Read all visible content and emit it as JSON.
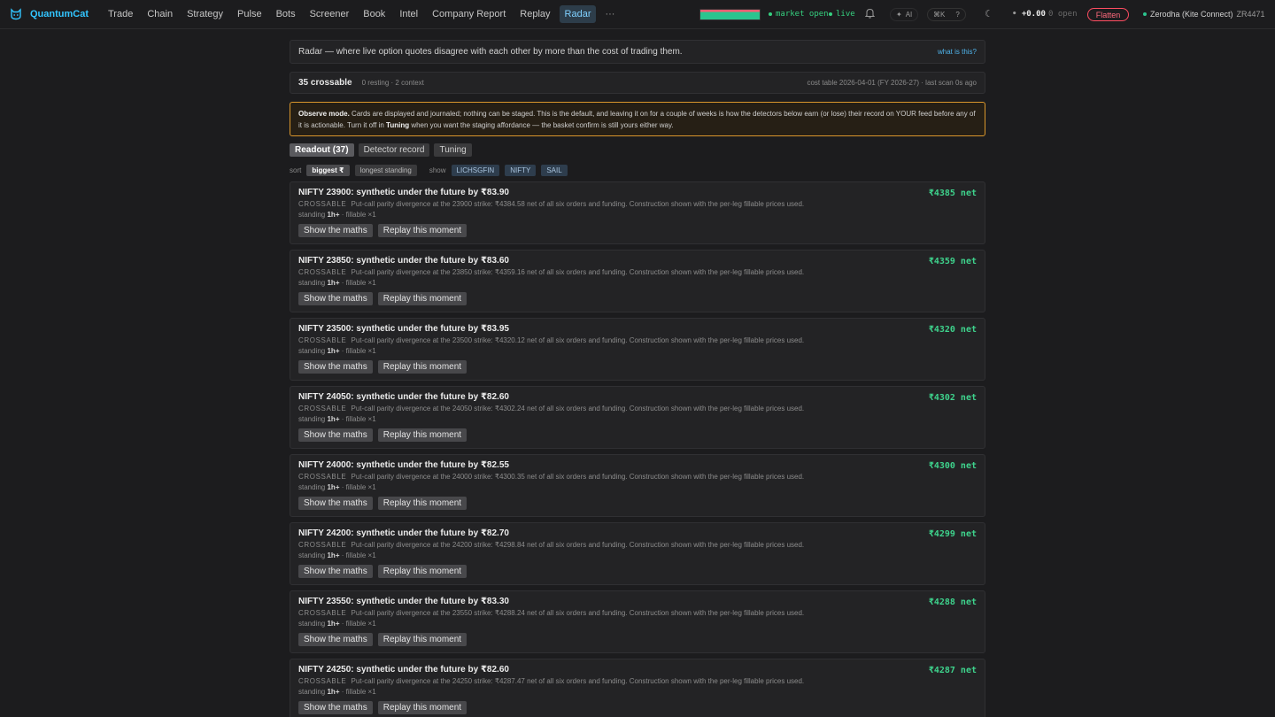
{
  "brand": {
    "name": "QuantumCat",
    "icon": "cat-logo-icon",
    "color": "#32c5ff"
  },
  "nav": {
    "items": [
      "Trade",
      "Chain",
      "Strategy",
      "Pulse",
      "Bots",
      "Screener",
      "Book",
      "Intel",
      "Company Report",
      "Replay",
      "Radar"
    ],
    "active": "Radar",
    "more": "···"
  },
  "status": {
    "market": "market open",
    "live": "live",
    "ai": "AI",
    "shortcut": "⌘K",
    "help": "?",
    "pnl": "+0.00",
    "open": "0 open",
    "flatten": "Flatten",
    "broker": "Zerodha (Kite Connect)",
    "account": "ZR4471",
    "health_fraction": 1.0
  },
  "colors": {
    "accent": "#32c5ff",
    "positive": "#3ed28c",
    "warning_border": "#d9962c",
    "danger": "#ff4d62"
  },
  "intro": {
    "text": "Radar — where live option quotes disagree with each other by more than the cost of trading them.",
    "link": "what is this?"
  },
  "summary": {
    "crossable": "35 crossable",
    "counts": "0 resting · 2 context",
    "scan": "cost table 2026-04-01 (FY 2026-27) · last scan 0s ago"
  },
  "observe": {
    "title": "Observe mode.",
    "body_1": "Cards are displayed and journaled; nothing can be staged. This is the default, and leaving it on for a couple of weeks is how the detectors below earn (or lose) their record on YOUR feed before any of it is actionable. Turn it off in",
    "tuning": "Tuning",
    "body_2": "when you want the staging affordance — the basket confirm is still yours either way."
  },
  "tabs": [
    {
      "label": "Readout (37)",
      "active": true
    },
    {
      "label": "Detector record",
      "active": false
    },
    {
      "label": "Tuning",
      "active": false
    }
  ],
  "sort": {
    "label": "sort",
    "options": [
      "biggest ₹",
      "longest standing"
    ],
    "show_label": "show",
    "show_options": [
      "LICHSGFIN",
      "NIFTY",
      "SAIL"
    ]
  },
  "card_labels": {
    "tag": "CROSSABLE",
    "standing": "standing",
    "maths": "Show the maths",
    "replay": "Replay this moment"
  },
  "cards": [
    {
      "title": "NIFTY 23900: synthetic under the future by ₹83.90",
      "net": "₹4385 net",
      "desc": "Put-call parity divergence at the 23900 strike: ₹4384.58 net of all six orders and funding. Construction shown with the per-leg fillable prices used.",
      "standing": "1h+",
      "fillable": "· fillable ×1"
    },
    {
      "title": "NIFTY 23850: synthetic under the future by ₹83.60",
      "net": "₹4359 net",
      "desc": "Put-call parity divergence at the 23850 strike: ₹4359.16 net of all six orders and funding. Construction shown with the per-leg fillable prices used.",
      "standing": "1h+",
      "fillable": "· fillable ×1"
    },
    {
      "title": "NIFTY 23500: synthetic under the future by ₹83.95",
      "net": "₹4320 net",
      "desc": "Put-call parity divergence at the 23500 strike: ₹4320.12 net of all six orders and funding. Construction shown with the per-leg fillable prices used.",
      "standing": "1h+",
      "fillable": "· fillable ×1"
    },
    {
      "title": "NIFTY 24050: synthetic under the future by ₹82.60",
      "net": "₹4302 net",
      "desc": "Put-call parity divergence at the 24050 strike: ₹4302.24 net of all six orders and funding. Construction shown with the per-leg fillable prices used.",
      "standing": "1h+",
      "fillable": "· fillable ×1"
    },
    {
      "title": "NIFTY 24000: synthetic under the future by ₹82.55",
      "net": "₹4300 net",
      "desc": "Put-call parity divergence at the 24000 strike: ₹4300.35 net of all six orders and funding. Construction shown with the per-leg fillable prices used.",
      "standing": "1h+",
      "fillable": "· fillable ×1"
    },
    {
      "title": "NIFTY 24200: synthetic under the future by ₹82.70",
      "net": "₹4299 net",
      "desc": "Put-call parity divergence at the 24200 strike: ₹4298.84 net of all six orders and funding. Construction shown with the per-leg fillable prices used.",
      "standing": "1h+",
      "fillable": "· fillable ×1"
    },
    {
      "title": "NIFTY 23550: synthetic under the future by ₹83.30",
      "net": "₹4288 net",
      "desc": "Put-call parity divergence at the 23550 strike: ₹4288.24 net of all six orders and funding. Construction shown with the per-leg fillable prices used.",
      "standing": "1h+",
      "fillable": "· fillable ×1"
    },
    {
      "title": "NIFTY 24250: synthetic under the future by ₹82.60",
      "net": "₹4287 net",
      "desc": "Put-call parity divergence at the 24250 strike: ₹4287.47 net of all six orders and funding. Construction shown with the per-leg fillable prices used.",
      "standing": "1h+",
      "fillable": "· fillable ×1"
    }
  ]
}
